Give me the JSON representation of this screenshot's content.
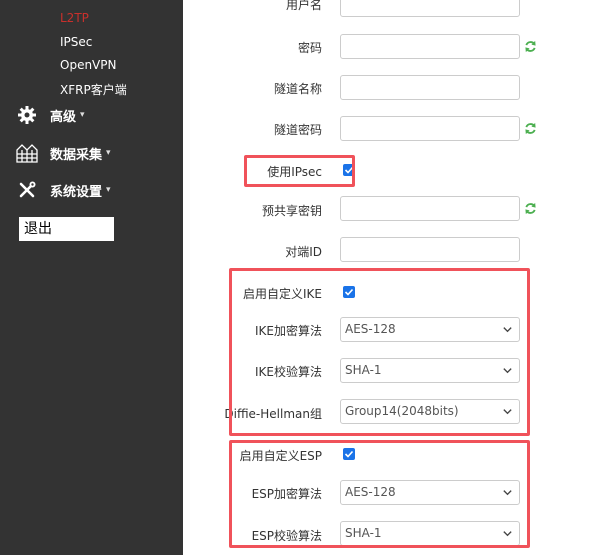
{
  "sidebar": {
    "sub_items": [
      "L2TP",
      "IPSec",
      "OpenVPN",
      "XFRP客户端"
    ],
    "active_sub": "L2TP",
    "nav": [
      {
        "label": "高级",
        "icon": "gear-icon"
      },
      {
        "label": "数据采集",
        "icon": "data-collection-icon"
      },
      {
        "label": "系统设置",
        "icon": "wrench-icon"
      }
    ],
    "logout": "退出"
  },
  "form": {
    "username_label": "用户名",
    "password_label": "密码",
    "tunnel_name_label": "隧道名称",
    "tunnel_password_label": "隧道密码",
    "use_ipsec_label": "使用IPsec",
    "psk_label": "预共享密钥",
    "peer_id_label": "对端ID",
    "custom_ike_label": "启用自定义IKE",
    "ike_enc_label": "IKE加密算法",
    "ike_enc_value": "AES-128",
    "ike_hash_label": "IKE校验算法",
    "ike_hash_value": "SHA-1",
    "dh_label": "Diffie-Hellman组",
    "dh_value": "Group14(2048bits)",
    "custom_esp_label": "启用自定义ESP",
    "esp_enc_label": "ESP加密算法",
    "esp_enc_value": "AES-128",
    "esp_hash_label": "ESP校验算法",
    "esp_hash_value": "SHA-1"
  },
  "colors": {
    "sidebar_bg": "#333333",
    "active": "#c9302c",
    "checkbox": "#1a73e8",
    "highlight": "#f0525a",
    "refresh_icon": "#4caf50"
  }
}
